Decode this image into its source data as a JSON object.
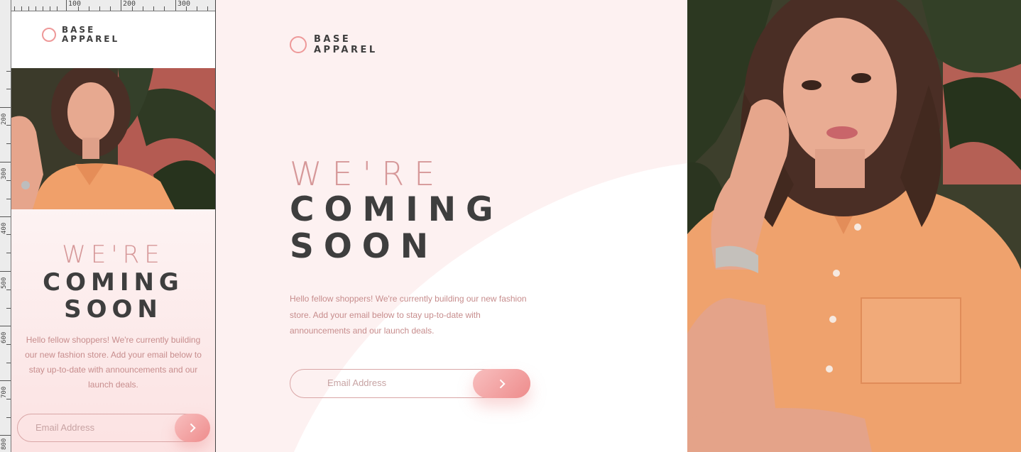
{
  "mobile": {
    "ruler": {
      "top_labels": [
        "100",
        "200",
        "300"
      ],
      "left_labels": [
        "200",
        "300",
        "400",
        "500",
        "600",
        "700",
        "800"
      ]
    },
    "brand": {
      "line1": "BASE",
      "line2": "APPAREL"
    },
    "headline": {
      "light": "WE'RE",
      "bold1": "COMING",
      "bold2": "SOON"
    },
    "description": "Hello fellow shoppers! We're currently building our new fashion store. Add your email below to stay up-to-date with announcements and our launch deals.",
    "email_placeholder": "Email Address"
  },
  "desktop": {
    "brand": {
      "line1": "BASE",
      "line2": "APPAREL"
    },
    "headline": {
      "light": "WE'RE",
      "bold1": "COMING",
      "bold2": "SOON"
    },
    "description": "Hello fellow shoppers! We're currently building our new fashion store. Add your email below to stay up-to-date with announcements and our launch deals.",
    "email_placeholder": "Email Address"
  },
  "colors": {
    "accent_pink": "#ee8c8c",
    "headline_light": "#d69899",
    "headline_dark": "#3e3e3e",
    "body_text": "#c78d8d",
    "background": "#fdf1f1"
  },
  "icons": {
    "submit": "chevron-right-icon",
    "logo": "ring-logo-icon"
  }
}
